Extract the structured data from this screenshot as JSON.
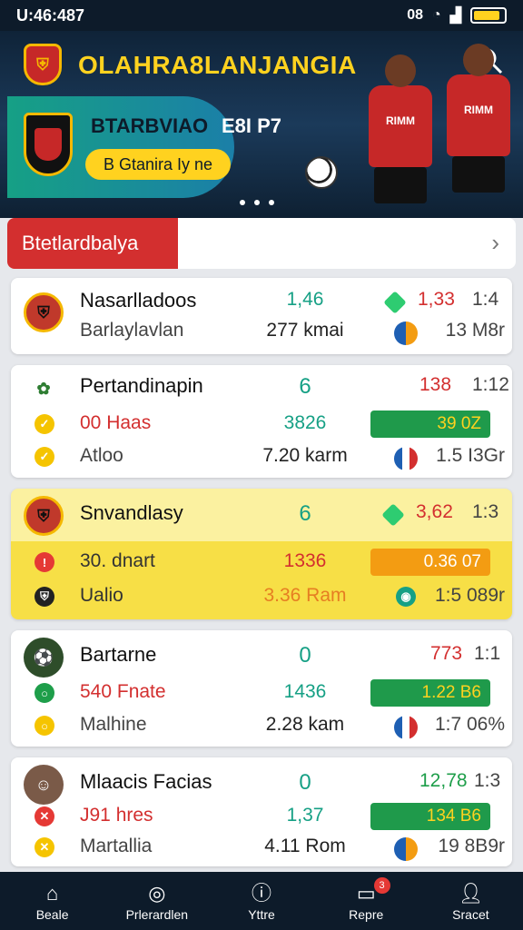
{
  "status": {
    "time": "U:46:487",
    "right_text": "08"
  },
  "header": {
    "app_title": "OLAHRA8LANJANGIA",
    "banner_title": "BTARBVIAO",
    "banner_subtitle": "E8I P7",
    "banner_pill": "B Gtanira Iy ne"
  },
  "section": {
    "label": "Btetlardbalya"
  },
  "matches": [
    {
      "name": "Nasarlladoos",
      "sub": "Barlaylavlan",
      "score": "1,46",
      "dist": "277 kmai",
      "odds": "1,33",
      "odds2": "1:4",
      "extra": "13 M8r"
    },
    {
      "name": "Pertandinapin",
      "score": "6",
      "odds": "138",
      "odds2": "1:12",
      "r2_label": "00 Haas",
      "r2_mid": "3826",
      "r2_pill": "39 0Z",
      "r3_label": "Atloo",
      "r3_mid": "7.20 karm",
      "r3_right": "1.5 I3Gr"
    },
    {
      "name": "Snvandlasy",
      "score": "6",
      "odds": "3,62",
      "odds2": "1:3",
      "r2_label": "30. dnart",
      "r2_mid": "1336",
      "r2_pill": "0.36 07",
      "r3_label": "Ualio",
      "r3_mid": "3.36 Ram",
      "r3_right": "1:5 089r"
    },
    {
      "name": "Bartarne",
      "score": "0",
      "odds": "773",
      "odds2": "1:1",
      "r2_label": "540 Fnate",
      "r2_mid": "1436",
      "r2_pill": "1.22 B6",
      "r3_label": "Malhine",
      "r3_mid": "2.28 kam",
      "r3_right": "1:7 06%"
    },
    {
      "name": "Mlaacis Facias",
      "score": "0",
      "odds": "12,78",
      "odds2": "1:3",
      "r2_label": "J91 hres",
      "r2_mid": "1,37",
      "r2_pill": "134 B6",
      "r3_label": "Martallia",
      "r3_mid": "4.11 Rom",
      "r3_right": "19 8B9r"
    }
  ],
  "nav": [
    {
      "label": "Beale",
      "icon": "home-icon"
    },
    {
      "label": "Prlerardlen",
      "icon": "target-icon"
    },
    {
      "label": "Yttre",
      "icon": "info-icon"
    },
    {
      "label": "Repre",
      "icon": "screen-icon",
      "badge": "3"
    },
    {
      "label": "Sracet",
      "icon": "user-icon"
    }
  ],
  "colors": {
    "accent": "#ffd21f",
    "primary_dark": "#0d1b2a",
    "red": "#d32f2f",
    "teal": "#16a085",
    "green": "#1f9a4b",
    "orange": "#f39c12"
  }
}
